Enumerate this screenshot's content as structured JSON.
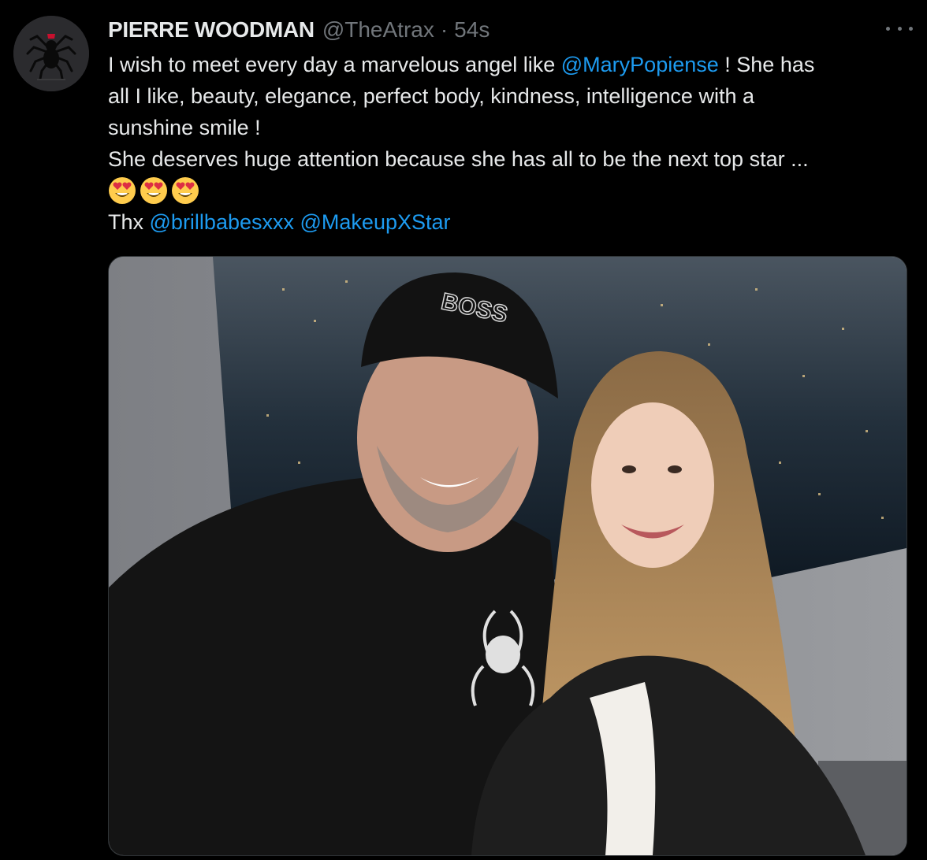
{
  "tweet": {
    "display_name": "PIERRE WOODMAN",
    "handle": "@TheAtrax",
    "separator": "·",
    "time": "54s",
    "text": {
      "line1_pre": "I wish to meet every day a marvelous angel like ",
      "line1_mention": "@MaryPopiense",
      "line1_post": " ! She has",
      "line2": "all I like, beauty, elegance, perfect body, kindness, intelligence with a",
      "line3": "sunshine smile !",
      "line4": "She deserves huge attention because she has all to be the next top star ...",
      "line6_pre": "Thx ",
      "line6_mention1": "@brillbabesxxx",
      "line6_mention2": "@MakeupXStar"
    },
    "emojis": [
      "smiling-face-with-heart-eyes",
      "smiling-face-with-heart-eyes",
      "smiling-face-with-heart-eyes"
    ],
    "photo": {
      "cap_text": "BOSS"
    }
  },
  "icons": {
    "avatar": "spider-logo-icon",
    "more": "more-options-icon"
  },
  "colors": {
    "background": "#000000",
    "text": "#e7e9ea",
    "muted": "#71767b",
    "link": "#1d9bf0"
  }
}
